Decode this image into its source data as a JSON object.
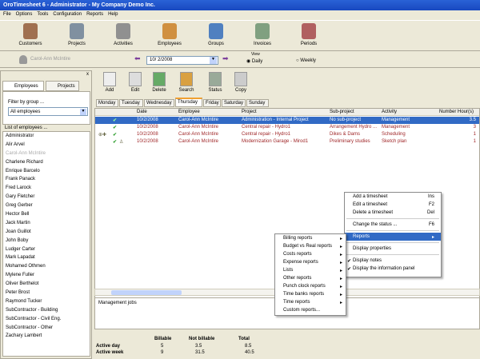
{
  "window": {
    "title": "OroTimesheet 6 - Administrator - My Company Demo Inc."
  },
  "menu": [
    "File",
    "Options",
    "Tools",
    "Configuration",
    "Reports",
    "Help"
  ],
  "toolbar": [
    "Customers",
    "Projects",
    "Activities",
    "Employees",
    "Groups",
    "Invoices",
    "Periods"
  ],
  "datebar": {
    "employee": "Carol-Ann McIntire",
    "date": "10/ 2/2008",
    "view_label": "View",
    "daily": "Daily",
    "weekly": "Weekly"
  },
  "left": {
    "tabs": [
      "Employees",
      "Projects"
    ],
    "filter_label": "Filter by group ...",
    "filter_value": "All employees",
    "list_label": "List of employees ...",
    "employees": [
      "Administrator",
      "Alir Arvel",
      "Carol-Ann McIntire",
      "Charlene Richard",
      "Enrique Barcelo",
      "Frank Panack",
      "Fred Larock",
      "Gary Fletcher",
      "Greg Gerber",
      "Hector Bell",
      "Jack Martin",
      "Joan Guillot",
      "John Boby",
      "Ludger Carter",
      "Mark Lapadat",
      "Mohamed Othmen",
      "Mylene Fuller",
      "Oliver Berthelot",
      "Peter Brost",
      "Raymond Tucker",
      "SubContractor - Building",
      "SubContractor - Civil Eng.",
      "SubContractor - Other",
      "Zachary Lambert"
    ]
  },
  "actions": [
    "Add",
    "Edit",
    "Delete",
    "Search",
    "Status",
    "Copy"
  ],
  "days": [
    "Monday",
    "Tuesday",
    "Wednesday",
    "Thursday",
    "Friday",
    "Saturday",
    "Sunday"
  ],
  "active_day": "Thursday",
  "table": {
    "headers": [
      "Date",
      "Employee",
      "Project",
      "Sub-project",
      "Activity",
      "Number Hour(s)"
    ],
    "rows": [
      [
        "10/2/2008",
        "Carol-Ann McIntire",
        "Administration - Internal Project",
        "No sub-project",
        "Management",
        "3.5"
      ],
      [
        "10/2/2008",
        "Carol-Ann McIntire",
        "Central repair - Hydro1",
        "Arrangement Hydro ...",
        "Management",
        "3"
      ],
      [
        "10/2/2008",
        "Carol-Ann McIntire",
        "Central repair - Hydro1",
        "Dikes & Dams",
        "Scheduling",
        "1"
      ],
      [
        "10/2/2008",
        "Carol-Ann McIntire",
        "Modernization Garage - Mirod1",
        "Preliminary studies",
        "Sketch plan",
        "1"
      ]
    ]
  },
  "context_menu": {
    "items": [
      {
        "label": "Add a timesheet",
        "key": "Ins"
      },
      {
        "label": "Edit a timesheet",
        "key": "F2"
      },
      {
        "label": "Delete a timesheet",
        "key": "Del"
      },
      {
        "label": "Change the status ...",
        "key": "F6"
      },
      {
        "label": "Reports"
      },
      {
        "label": "Display properties"
      },
      {
        "label": "Display notes",
        "checked": true
      },
      {
        "label": "Display the information panel",
        "checked": true
      }
    ]
  },
  "submenu": [
    "Billing reports",
    "Budget vs Real reports",
    "Costs reports",
    "Expense reports",
    "Lists",
    "Other reports",
    "Punch clock reports",
    "Time banks reports",
    "Time reports",
    "Custom reports..."
  ],
  "notes": "Management jobs",
  "totals": {
    "headers": [
      "Billable",
      "Not billable",
      "Total"
    ],
    "rows": [
      {
        "label": "Active day",
        "values": [
          "5",
          "3.5",
          "8.5"
        ]
      },
      {
        "label": "Active week",
        "values": [
          "9",
          "31.5",
          "40.5"
        ]
      }
    ]
  },
  "colors": {
    "title_bar": "#2a62d6",
    "selection": "#316ac5",
    "row_text": "#a0282a",
    "check": "#2e9e2e"
  }
}
